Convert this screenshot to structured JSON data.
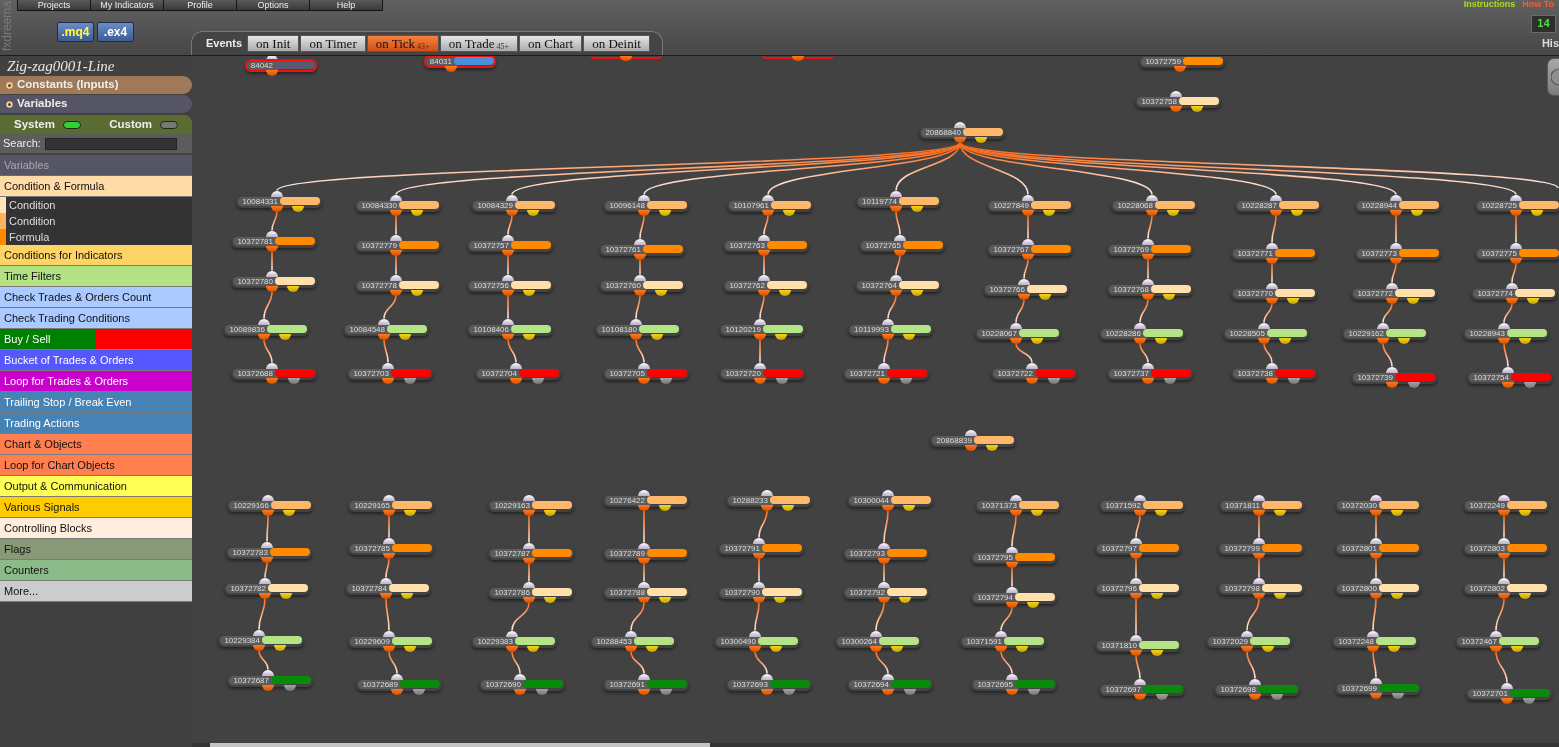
{
  "brand": "fxdreema",
  "menu": [
    "Projects",
    "My Indicators",
    "Profile",
    "Options",
    "Help"
  ],
  "top_links": [
    {
      "label": "Instructions",
      "color": "#a4e01c"
    },
    {
      "label": "How To",
      "color": "#ff5a28"
    }
  ],
  "file_buttons": [
    {
      "label": ".mq4",
      "color": "#ffff33"
    },
    {
      "label": ".ex4",
      "color": "#ffffff"
    }
  ],
  "events": {
    "label": "Events",
    "tabs": [
      {
        "label": "on Init",
        "selected": false
      },
      {
        "label": "on Timer",
        "selected": false
      },
      {
        "label": "on Tick",
        "selected": true,
        "badge": "43+"
      },
      {
        "label": "on Trade",
        "selected": false,
        "badge": "45+"
      },
      {
        "label": "on Chart",
        "selected": false
      },
      {
        "label": "on Deinit",
        "selected": false
      }
    ]
  },
  "counter": "14",
  "history_label": "His",
  "sidebar": {
    "project_name": "Zig-zag0001-Line",
    "sections": [
      {
        "label": "Constants (Inputs)",
        "color": "#a07a58"
      },
      {
        "label": "Variables",
        "color": "#555566"
      }
    ],
    "toggles": [
      {
        "label": "System",
        "on": true
      },
      {
        "label": "Custom",
        "on": false
      }
    ],
    "search": {
      "label": "Search:"
    },
    "categories": [
      {
        "label": "Variables",
        "kind": "header",
        "color": "#555566"
      },
      {
        "label": "Condition & Formula",
        "kind": "category",
        "color": "#ffdba8",
        "children": [
          {
            "label": "Condition",
            "color": "#ffe2b8"
          },
          {
            "label": "Condition",
            "color": "#ffb25e"
          },
          {
            "label": "Formula",
            "color": "#ff8a00"
          }
        ]
      },
      {
        "label": "Conditions for Indicators",
        "kind": "category",
        "color": "#ffd466"
      },
      {
        "label": "Time Filters",
        "kind": "category",
        "color": "#b2e284"
      },
      {
        "label": "Check Trades & Orders Count",
        "kind": "category",
        "color": "#abcaff"
      },
      {
        "label": "Check Trading Conditions",
        "kind": "category",
        "color": "#abcaff"
      },
      {
        "label": "Buy / Sell",
        "kind": "split",
        "color": "#008000",
        "band": {
          "color": "#ff0000"
        }
      },
      {
        "label": "Bucket of Trades & Orders",
        "kind": "category",
        "color": "#5757ff"
      },
      {
        "label": "Loop for Trades & Orders",
        "kind": "category",
        "color": "#cc00cc"
      },
      {
        "label": "Trailing Stop / Break Even",
        "kind": "category",
        "color": "#4682b4"
      },
      {
        "label": "Trading Actions",
        "kind": "category",
        "color": "#4682b4"
      },
      {
        "label": "Chart & Objects",
        "kind": "category",
        "color": "#ff7f50"
      },
      {
        "label": "Loop for Chart Objects",
        "kind": "category",
        "color": "#ff7f50"
      },
      {
        "label": "Output & Communication",
        "kind": "category",
        "color": "#ffff55"
      },
      {
        "label": "Various Signals",
        "kind": "category",
        "color": "#ffcc00"
      },
      {
        "label": "Controlling Blocks",
        "kind": "category",
        "color": "#ffeedd"
      },
      {
        "label": "Flags",
        "kind": "category",
        "color": "#889977"
      },
      {
        "label": "Counters",
        "kind": "category",
        "color": "#8bbb88"
      },
      {
        "label": "More...",
        "kind": "category",
        "color": "#cccccc"
      }
    ]
  },
  "canvas": {
    "nodes": [
      {
        "id": "84042",
        "color": "#5a5a6e",
        "kind": "pass",
        "selected": true
      },
      {
        "id": "84031",
        "color": "#4a8fd8",
        "kind": "pass",
        "selected": true
      },
      {
        "kind": "pass",
        "selected": true
      },
      {
        "kind": "pass",
        "selected": true
      },
      {
        "id": "10372759",
        "color": "#ff8a00",
        "kind": "pass",
        "selected": false
      },
      {
        "id": "10372758",
        "color": "#ffe0aa",
        "kind": "branch",
        "selected": false
      },
      {
        "id": "20868840",
        "color": "#ffb86a",
        "kind": "branch",
        "selected": false,
        "children": [
          {
            "id": "10084331",
            "color": "#ffb86a",
            "kind": "branch",
            "selected": false,
            "children": [
              {
                "id": "10372781",
                "color": "#ff8a00",
                "kind": "pass",
                "selected": false,
                "children": [
                  {
                    "id": "10372780",
                    "color": "#ffe0aa",
                    "kind": "branch",
                    "selected": false,
                    "children": [
                      {
                        "id": "10089836",
                        "color": "#b4e486",
                        "kind": "branch",
                        "selected": false,
                        "children": [
                          {
                            "id": "10372688",
                            "color": "#ff0000",
                            "kind": "action",
                            "selected": false
                          }
                        ]
                      }
                    ]
                  }
                ]
              }
            ]
          },
          {
            "id": "10084330",
            "color": "#ffb86a",
            "kind": "branch",
            "selected": false,
            "children": [
              {
                "id": "10372779",
                "color": "#ff8a00",
                "kind": "pass",
                "selected": false,
                "children": [
                  {
                    "id": "10372778",
                    "color": "#ffe0aa",
                    "kind": "branch",
                    "selected": false,
                    "children": [
                      {
                        "id": "10084548",
                        "color": "#b4e486",
                        "kind": "branch",
                        "selected": false,
                        "children": [
                          {
                            "id": "10372703",
                            "color": "#ff0000",
                            "kind": "action",
                            "selected": false
                          }
                        ]
                      }
                    ]
                  }
                ]
              }
            ]
          },
          {
            "id": "10084329",
            "color": "#ffb86a",
            "kind": "branch",
            "selected": false,
            "children": [
              {
                "id": "10372757",
                "color": "#ff8a00",
                "kind": "pass",
                "selected": false,
                "children": [
                  {
                    "id": "10372756",
                    "color": "#ffe0aa",
                    "kind": "branch",
                    "selected": false,
                    "children": [
                      {
                        "id": "10108406",
                        "color": "#b4e486",
                        "kind": "branch",
                        "selected": false,
                        "children": [
                          {
                            "id": "10372704",
                            "color": "#ff0000",
                            "kind": "action",
                            "selected": false
                          }
                        ]
                      }
                    ]
                  }
                ]
              }
            ]
          },
          {
            "id": "10096148",
            "color": "#ffb86a",
            "kind": "branch",
            "selected": false,
            "children": [
              {
                "id": "10372761",
                "color": "#ff8a00",
                "kind": "pass",
                "selected": false,
                "children": [
                  {
                    "id": "10372760",
                    "color": "#ffe0aa",
                    "kind": "branch",
                    "selected": false,
                    "children": [
                      {
                        "id": "10108180",
                        "color": "#b4e486",
                        "kind": "branch",
                        "selected": false,
                        "children": [
                          {
                            "id": "10372705",
                            "color": "#ff0000",
                            "kind": "action",
                            "selected": false
                          }
                        ]
                      }
                    ]
                  }
                ]
              }
            ]
          },
          {
            "id": "10107961",
            "color": "#ffb86a",
            "kind": "branch",
            "selected": false,
            "children": [
              {
                "id": "10372763",
                "color": "#ff8a00",
                "kind": "pass",
                "selected": false,
                "children": [
                  {
                    "id": "10372762",
                    "color": "#ffe0aa",
                    "kind": "branch",
                    "selected": false,
                    "children": [
                      {
                        "id": "10120219",
                        "color": "#b4e486",
                        "kind": "branch",
                        "selected": false,
                        "children": [
                          {
                            "id": "10372720",
                            "color": "#ff0000",
                            "kind": "action",
                            "selected": false
                          }
                        ]
                      }
                    ]
                  }
                ]
              }
            ]
          },
          {
            "id": "10119774",
            "color": "#ffb86a",
            "kind": "branch",
            "selected": false,
            "children": [
              {
                "id": "10372765",
                "color": "#ff8a00",
                "kind": "pass",
                "selected": false,
                "children": [
                  {
                    "id": "10372764",
                    "color": "#ffe0aa",
                    "kind": "branch",
                    "selected": false,
                    "children": [
                      {
                        "id": "10119993",
                        "color": "#b4e486",
                        "kind": "branch",
                        "selected": false,
                        "children": [
                          {
                            "id": "10372721",
                            "color": "#ff0000",
                            "kind": "action",
                            "selected": false
                          }
                        ]
                      }
                    ]
                  }
                ]
              }
            ]
          },
          {
            "id": "10227849",
            "color": "#ffb86a",
            "kind": "branch",
            "selected": false,
            "children": [
              {
                "id": "10372767",
                "color": "#ff8a00",
                "kind": "pass",
                "selected": false,
                "children": [
                  {
                    "id": "10372766",
                    "color": "#ffe0aa",
                    "kind": "branch",
                    "selected": false,
                    "children": [
                      {
                        "id": "10228067",
                        "color": "#b4e486",
                        "kind": "branch",
                        "selected": false,
                        "children": [
                          {
                            "id": "10372722",
                            "color": "#ff0000",
                            "kind": "action",
                            "selected": false
                          }
                        ]
                      }
                    ]
                  }
                ]
              }
            ]
          },
          {
            "id": "10228068",
            "color": "#ffb86a",
            "kind": "branch",
            "selected": false,
            "children": [
              {
                "id": "10372769",
                "color": "#ff8a00",
                "kind": "pass",
                "selected": false,
                "children": [
                  {
                    "id": "10372768",
                    "color": "#ffe0aa",
                    "kind": "branch",
                    "selected": false,
                    "children": [
                      {
                        "id": "10228286",
                        "color": "#b4e486",
                        "kind": "branch",
                        "selected": false,
                        "children": [
                          {
                            "id": "10372737",
                            "color": "#ff0000",
                            "kind": "action",
                            "selected": false
                          }
                        ]
                      }
                    ]
                  }
                ]
              }
            ]
          },
          {
            "id": "10228287",
            "color": "#ffb86a",
            "kind": "branch",
            "selected": false,
            "children": [
              {
                "id": "10372771",
                "color": "#ff8a00",
                "kind": "pass",
                "selected": false,
                "children": [
                  {
                    "id": "10372770",
                    "color": "#ffe0aa",
                    "kind": "branch",
                    "selected": false,
                    "children": [
                      {
                        "id": "10228505",
                        "color": "#b4e486",
                        "kind": "branch",
                        "selected": false,
                        "children": [
                          {
                            "id": "10372738",
                            "color": "#ff0000",
                            "kind": "action",
                            "selected": false
                          }
                        ]
                      }
                    ]
                  }
                ]
              }
            ]
          },
          {
            "id": "10228944",
            "color": "#ffb86a",
            "kind": "branch",
            "selected": false,
            "children": [
              {
                "id": "10372773",
                "color": "#ff8a00",
                "kind": "pass",
                "selected": false,
                "children": [
                  {
                    "id": "10372772",
                    "color": "#ffe0aa",
                    "kind": "branch",
                    "selected": false,
                    "children": [
                      {
                        "id": "10229162",
                        "color": "#b4e486",
                        "kind": "branch",
                        "selected": false,
                        "children": [
                          {
                            "id": "10372739",
                            "color": "#ff0000",
                            "kind": "action",
                            "selected": false
                          }
                        ]
                      }
                    ]
                  }
                ]
              }
            ]
          },
          {
            "id": "10228725",
            "color": "#ffb86a",
            "kind": "branch",
            "selected": false,
            "children": [
              {
                "id": "10372775",
                "color": "#ff8a00",
                "kind": "pass",
                "selected": false,
                "children": [
                  {
                    "id": "10372774",
                    "color": "#ffe0aa",
                    "kind": "branch",
                    "selected": false,
                    "children": [
                      {
                        "id": "10228943",
                        "color": "#b4e486",
                        "kind": "branch",
                        "selected": false,
                        "children": [
                          {
                            "id": "10372754",
                            "color": "#ff0000",
                            "kind": "action",
                            "selected": false
                          }
                        ]
                      }
                    ]
                  }
                ]
              }
            ]
          }
        ]
      },
      {
        "id": "20868839",
        "color": "#ffb86a",
        "kind": "branch",
        "selected": false
      },
      {
        "id": "10229166",
        "color": "#ffb86a",
        "kind": "branch",
        "selected": false,
        "children": [
          {
            "id": "10372783",
            "color": "#ff8a00",
            "kind": "pass",
            "selected": false,
            "children": [
              {
                "id": "10372782",
                "color": "#ffe0aa",
                "kind": "branch",
                "selected": false,
                "children": [
                  {
                    "id": "10229384",
                    "color": "#b4e486",
                    "kind": "branch",
                    "selected": false,
                    "children": [
                      {
                        "id": "10372687",
                        "color": "#0a8a0a",
                        "kind": "action",
                        "selected": false
                      }
                    ]
                  }
                ]
              }
            ]
          }
        ]
      },
      {
        "id": "10229165",
        "color": "#ffb86a",
        "kind": "branch",
        "selected": false,
        "children": [
          {
            "id": "10372785",
            "color": "#ff8a00",
            "kind": "pass",
            "selected": false,
            "children": [
              {
                "id": "10372784",
                "color": "#ffe0aa",
                "kind": "branch",
                "selected": false,
                "children": [
                  {
                    "id": "10229609",
                    "color": "#b4e486",
                    "kind": "branch",
                    "selected": false,
                    "children": [
                      {
                        "id": "10372689",
                        "color": "#0a8a0a",
                        "kind": "action",
                        "selected": false
                      }
                    ]
                  }
                ]
              }
            ]
          }
        ]
      },
      {
        "id": "10229163",
        "color": "#ffb86a",
        "kind": "branch",
        "selected": false,
        "children": [
          {
            "id": "10372787",
            "color": "#ff8a00",
            "kind": "pass",
            "selected": false,
            "children": [
              {
                "id": "10372786",
                "color": "#ffe0aa",
                "kind": "branch",
                "selected": false,
                "children": [
                  {
                    "id": "10229383",
                    "color": "#b4e486",
                    "kind": "branch",
                    "selected": false,
                    "children": [
                      {
                        "id": "10372690",
                        "color": "#0a8a0a",
                        "kind": "action",
                        "selected": false
                      }
                    ]
                  }
                ]
              }
            ]
          }
        ]
      },
      {
        "id": "10276422",
        "color": "#ffb86a",
        "kind": "branch",
        "selected": false,
        "children": [
          {
            "id": "10372789",
            "color": "#ff8a00",
            "kind": "pass",
            "selected": false,
            "children": [
              {
                "id": "10372788",
                "color": "#ffe0aa",
                "kind": "branch",
                "selected": false,
                "children": [
                  {
                    "id": "10288453",
                    "color": "#b4e486",
                    "kind": "branch",
                    "selected": false,
                    "children": [
                      {
                        "id": "10372691",
                        "color": "#0a8a0a",
                        "kind": "action",
                        "selected": false
                      }
                    ]
                  }
                ]
              }
            ]
          }
        ]
      },
      {
        "id": "10288233",
        "color": "#ffb86a",
        "kind": "branch",
        "selected": false,
        "children": [
          {
            "id": "10372791",
            "color": "#ff8a00",
            "kind": "pass",
            "selected": false,
            "children": [
              {
                "id": "10372790",
                "color": "#ffe0aa",
                "kind": "branch",
                "selected": false,
                "children": [
                  {
                    "id": "10300490",
                    "color": "#b4e486",
                    "kind": "branch",
                    "selected": false,
                    "children": [
                      {
                        "id": "10372693",
                        "color": "#0a8a0a",
                        "kind": "action",
                        "selected": false
                      }
                    ]
                  }
                ]
              }
            ]
          }
        ]
      },
      {
        "id": "10300044",
        "color": "#ffb86a",
        "kind": "branch",
        "selected": false,
        "children": [
          {
            "id": "10372793",
            "color": "#ff8a00",
            "kind": "pass",
            "selected": false,
            "children": [
              {
                "id": "10372792",
                "color": "#ffe0aa",
                "kind": "branch",
                "selected": false,
                "children": [
                  {
                    "id": "10300264",
                    "color": "#b4e486",
                    "kind": "branch",
                    "selected": false,
                    "children": [
                      {
                        "id": "10372694",
                        "color": "#0a8a0a",
                        "kind": "action",
                        "selected": false
                      }
                    ]
                  }
                ]
              }
            ]
          }
        ]
      },
      {
        "id": "10371373",
        "color": "#ffb86a",
        "kind": "branch",
        "selected": false,
        "children": [
          {
            "id": "10372795",
            "color": "#ff8a00",
            "kind": "pass",
            "selected": false,
            "children": [
              {
                "id": "10372794",
                "color": "#ffe0aa",
                "kind": "branch",
                "selected": false,
                "children": [
                  {
                    "id": "10371591",
                    "color": "#b4e486",
                    "kind": "branch",
                    "selected": false,
                    "children": [
                      {
                        "id": "10372695",
                        "color": "#0a8a0a",
                        "kind": "action",
                        "selected": false
                      }
                    ]
                  }
                ]
              }
            ]
          }
        ]
      },
      {
        "id": "10371592",
        "color": "#ffb86a",
        "kind": "branch",
        "selected": false,
        "children": [
          {
            "id": "10372797",
            "color": "#ff8a00",
            "kind": "pass",
            "selected": false,
            "children": [
              {
                "id": "10372796",
                "color": "#ffe0aa",
                "kind": "branch",
                "selected": false,
                "children": [
                  {
                    "id": "10371810",
                    "color": "#b4e486",
                    "kind": "branch",
                    "selected": false,
                    "children": [
                      {
                        "id": "10372697",
                        "color": "#0a8a0a",
                        "kind": "action",
                        "selected": false
                      }
                    ]
                  }
                ]
              }
            ]
          }
        ]
      },
      {
        "id": "10371811",
        "color": "#ffb86a",
        "kind": "branch",
        "selected": false,
        "children": [
          {
            "id": "10372799",
            "color": "#ff8a00",
            "kind": "pass",
            "selected": false,
            "children": [
              {
                "id": "10372798",
                "color": "#ffe0aa",
                "kind": "branch",
                "selected": false,
                "children": [
                  {
                    "id": "10372029",
                    "color": "#b4e486",
                    "kind": "branch",
                    "selected": false,
                    "children": [
                      {
                        "id": "10372698",
                        "color": "#0a8a0a",
                        "kind": "action",
                        "selected": false
                      }
                    ]
                  }
                ]
              }
            ]
          }
        ]
      },
      {
        "id": "10372030",
        "color": "#ffb86a",
        "kind": "branch",
        "selected": false,
        "children": [
          {
            "id": "10372801",
            "color": "#ff8a00",
            "kind": "pass",
            "selected": false,
            "children": [
              {
                "id": "10372800",
                "color": "#ffe0aa",
                "kind": "branch",
                "selected": false,
                "children": [
                  {
                    "id": "10372248",
                    "color": "#b4e486",
                    "kind": "branch",
                    "selected": false,
                    "children": [
                      {
                        "id": "10372699",
                        "color": "#0a8a0a",
                        "kind": "action",
                        "selected": false
                      }
                    ]
                  }
                ]
              }
            ]
          }
        ]
      },
      {
        "id": "10372249",
        "color": "#ffb86a",
        "kind": "branch",
        "selected": false,
        "children": [
          {
            "id": "10372803",
            "color": "#ff8a00",
            "kind": "pass",
            "selected": false,
            "children": [
              {
                "id": "10372802",
                "color": "#ffe0aa",
                "kind": "branch",
                "selected": false,
                "children": [
                  {
                    "id": "10372467",
                    "color": "#b4e486",
                    "kind": "branch",
                    "selected": false,
                    "children": [
                      {
                        "id": "10372701",
                        "color": "#0a8a0a",
                        "kind": "action",
                        "selected": false
                      }
                    ]
                  }
                ]
              }
            ]
          }
        ]
      }
    ]
  }
}
